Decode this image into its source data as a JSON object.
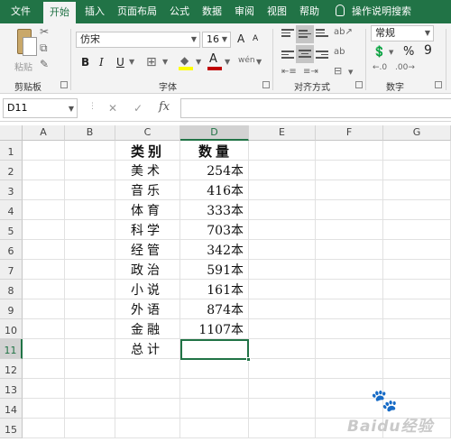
{
  "menu": {
    "tabs": [
      "文件",
      "开始",
      "插入",
      "页面布局",
      "公式",
      "数据",
      "审阅",
      "视图",
      "帮助"
    ],
    "active_tab": "开始",
    "tell_me": "操作说明搜索"
  },
  "ribbon": {
    "clipboard": {
      "paste_label": "粘贴",
      "group_label": "剪贴板"
    },
    "font": {
      "font_name": "仿宋",
      "font_size": "16",
      "bold": "B",
      "italic": "I",
      "underline": "U",
      "group_label": "字体",
      "grow": "A",
      "shrink": "A",
      "wen": "wén",
      "font_color": "#c00000",
      "fill_color": "#ffff00"
    },
    "alignment": {
      "group_label": "对齐方式",
      "wrap_glyph": "ab"
    },
    "number": {
      "format": "常规",
      "percent": "%",
      "comma": "9",
      "group_label": "数字"
    }
  },
  "formula_bar": {
    "name_box": "D11",
    "fx": "fx",
    "value": ""
  },
  "sheet": {
    "columns": [
      "A",
      "B",
      "C",
      "D",
      "E",
      "F",
      "G"
    ],
    "selected_column": "D",
    "rows": [
      "1",
      "2",
      "3",
      "4",
      "5",
      "6",
      "7",
      "8",
      "9",
      "10",
      "11",
      "12",
      "13",
      "14",
      "15"
    ],
    "selected_row": "11",
    "cells": {
      "C": [
        "类别",
        "美术",
        "音乐",
        "体育",
        "科学",
        "经管",
        "政治",
        "小说",
        "外语",
        "金融",
        "总计"
      ],
      "D": [
        "数量",
        "254本",
        "416本",
        "333本",
        "703本",
        "342本",
        "591本",
        "161本",
        "874本",
        "1107本",
        ""
      ]
    },
    "accent_color": "#217346"
  },
  "watermark": {
    "text": "Baidu经验"
  }
}
